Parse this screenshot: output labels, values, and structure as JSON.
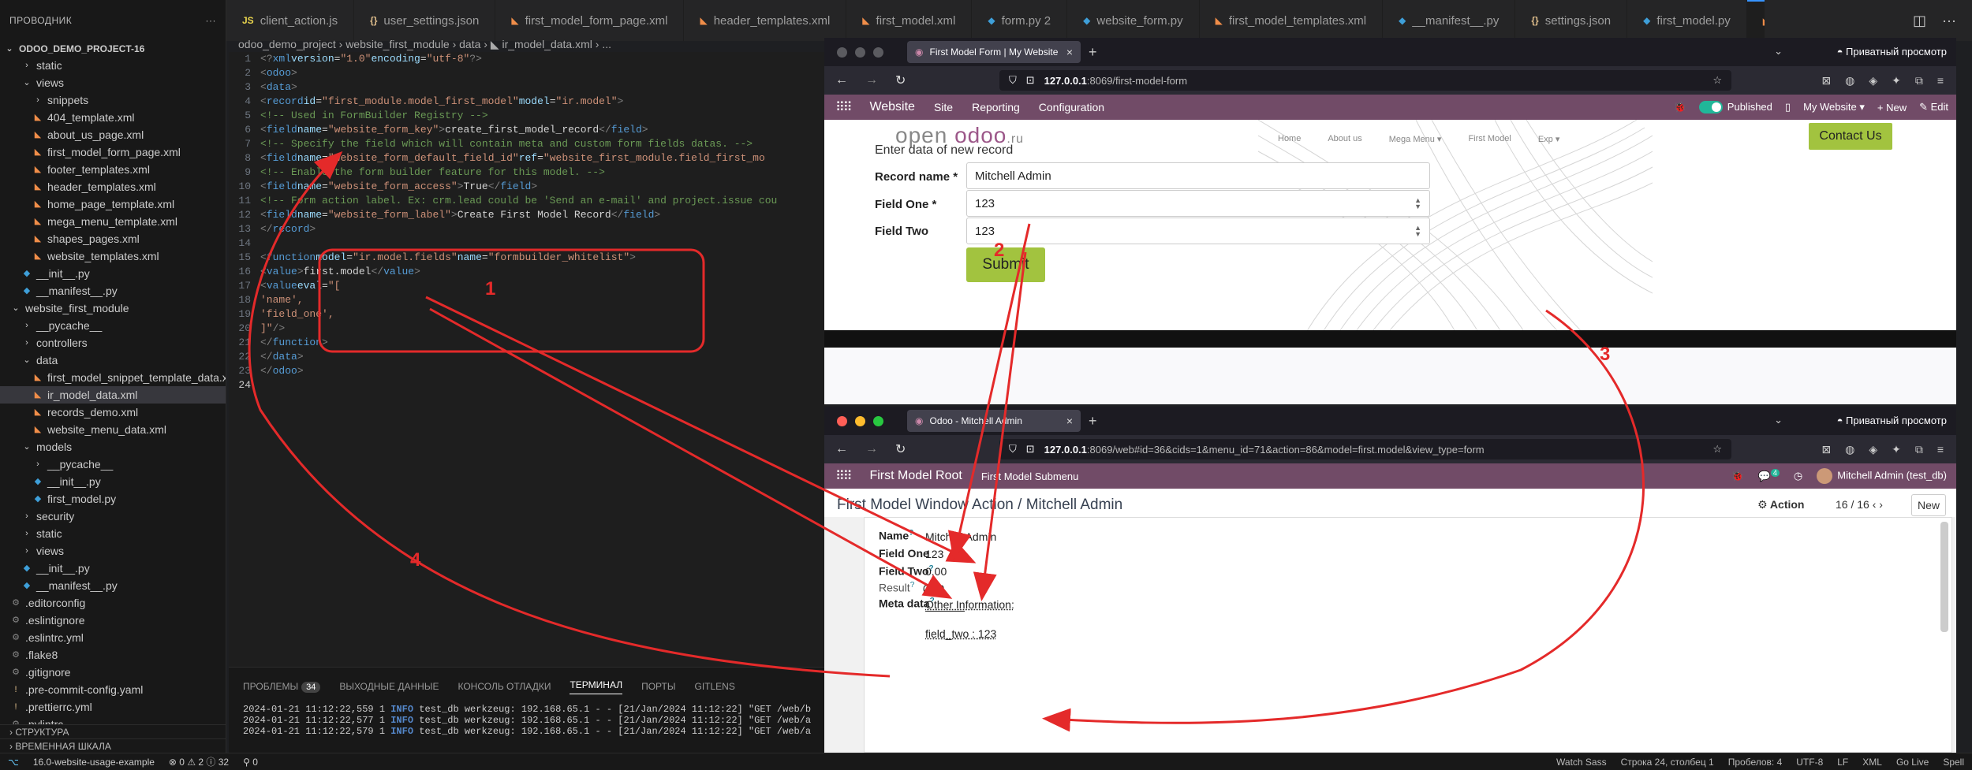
{
  "vscode": {
    "explorer_title": "ПРОВОДНИК",
    "project": "ODOO_DEMO_PROJECT-16",
    "tabs": [
      {
        "label": "client_action.js",
        "icon": "JS"
      },
      {
        "label": "user_settings.json",
        "icon": "{}"
      },
      {
        "label": "first_model_form_page.xml",
        "icon": "◣"
      },
      {
        "label": "header_templates.xml",
        "icon": "◣"
      },
      {
        "label": "first_model.xml",
        "icon": "◣"
      },
      {
        "label": "form.py 2",
        "icon": "◆"
      },
      {
        "label": "website_form.py",
        "icon": "◆"
      },
      {
        "label": "first_model_templates.xml",
        "icon": "◣"
      },
      {
        "label": "__manifest__.py",
        "icon": "◆"
      },
      {
        "label": "settings.json",
        "icon": "{}"
      },
      {
        "label": "first_model.py",
        "icon": "◆"
      },
      {
        "label": "ir_model_data.xml",
        "icon": "◣"
      }
    ],
    "tree": [
      {
        "label": "static",
        "depth": 1,
        "kind": "folder",
        "arrow": "›"
      },
      {
        "label": "views",
        "depth": 1,
        "kind": "folder",
        "arrow": "⌄"
      },
      {
        "label": "snippets",
        "depth": 2,
        "kind": "folder",
        "arrow": "›"
      },
      {
        "label": "404_template.xml",
        "depth": 2,
        "kind": "xml"
      },
      {
        "label": "about_us_page.xml",
        "depth": 2,
        "kind": "xml"
      },
      {
        "label": "first_model_form_page.xml",
        "depth": 2,
        "kind": "xml"
      },
      {
        "label": "footer_templates.xml",
        "depth": 2,
        "kind": "xml"
      },
      {
        "label": "header_templates.xml",
        "depth": 2,
        "kind": "xml"
      },
      {
        "label": "home_page_template.xml",
        "depth": 2,
        "kind": "xml"
      },
      {
        "label": "mega_menu_template.xml",
        "depth": 2,
        "kind": "xml"
      },
      {
        "label": "shapes_pages.xml",
        "depth": 2,
        "kind": "xml"
      },
      {
        "label": "website_templates.xml",
        "depth": 2,
        "kind": "xml"
      },
      {
        "label": "__init__.py",
        "depth": 1,
        "kind": "py"
      },
      {
        "label": "__manifest__.py",
        "depth": 1,
        "kind": "py"
      },
      {
        "label": "website_first_module",
        "depth": 0,
        "kind": "folder",
        "arrow": "⌄"
      },
      {
        "label": "__pycache__",
        "depth": 1,
        "kind": "folder",
        "arrow": "›"
      },
      {
        "label": "controllers",
        "depth": 1,
        "kind": "folder",
        "arrow": "›"
      },
      {
        "label": "data",
        "depth": 1,
        "kind": "folder",
        "arrow": "⌄"
      },
      {
        "label": "first_model_snippet_template_data.x...",
        "depth": 2,
        "kind": "xml"
      },
      {
        "label": "ir_model_data.xml",
        "depth": 2,
        "kind": "xml",
        "selected": true
      },
      {
        "label": "records_demo.xml",
        "depth": 2,
        "kind": "xml"
      },
      {
        "label": "website_menu_data.xml",
        "depth": 2,
        "kind": "xml"
      },
      {
        "label": "models",
        "depth": 1,
        "kind": "folder",
        "arrow": "⌄"
      },
      {
        "label": "__pycache__",
        "depth": 2,
        "kind": "folder",
        "arrow": "›"
      },
      {
        "label": "__init__.py",
        "depth": 2,
        "kind": "py"
      },
      {
        "label": "first_model.py",
        "depth": 2,
        "kind": "py"
      },
      {
        "label": "security",
        "depth": 1,
        "kind": "folder",
        "arrow": "›"
      },
      {
        "label": "static",
        "depth": 1,
        "kind": "folder",
        "arrow": "›"
      },
      {
        "label": "views",
        "depth": 1,
        "kind": "folder",
        "arrow": "›"
      },
      {
        "label": "__init__.py",
        "depth": 1,
        "kind": "py"
      },
      {
        "label": "__manifest__.py",
        "depth": 1,
        "kind": "py"
      },
      {
        "label": ".editorconfig",
        "depth": 0,
        "kind": "cfg"
      },
      {
        "label": ".eslintignore",
        "depth": 0,
        "kind": "cfg"
      },
      {
        "label": ".eslintrc.yml",
        "depth": 0,
        "kind": "cfg"
      },
      {
        "label": ".flake8",
        "depth": 0,
        "kind": "cfg"
      },
      {
        "label": ".gitignore",
        "depth": 0,
        "kind": "cfg"
      },
      {
        "label": ".pre-commit-config.yaml",
        "depth": 0,
        "kind": "yml"
      },
      {
        "label": ".prettierrc.yml",
        "depth": 0,
        "kind": "yml"
      },
      {
        "label": ".pylintrc",
        "depth": 0,
        "kind": "cfg"
      }
    ],
    "outline": "СТРУКТУРА",
    "timeline": "ВРЕМЕННАЯ ШКАЛА",
    "breadcrumbs": "odoo_demo_project  ›  website_first_module  ›  data  ›  ◣ ir_model_data.xml  ›  ...",
    "panel_tabs": [
      "ПРОБЛЕМЫ",
      "ВЫХОДНЫЕ ДАННЫЕ",
      "КОНСОЛЬ ОТЛАДКИ",
      "ТЕРМИНАЛ",
      "ПОРТЫ",
      "GITLENS"
    ],
    "problems_count": "34",
    "terminal": [
      {
        "ts": "2024-01-21 11:12:22,559 1 ",
        "lvl": "INFO",
        "rest": " test_db werkzeug: 192.168.65.1 - - [21/Jan/2024 11:12:22] \"GET /web/bundle"
      },
      {
        "ts": "2024-01-21 11:12:22,577 1 ",
        "lvl": "INFO",
        "rest": " test_db werkzeug: 192.168.65.1 - - [21/Jan/2024 11:12:22] \"GET /web/assets"
      },
      {
        "ts": "2024-01-21 11:12:22,579 1 ",
        "lvl": "INFO",
        "rest": " test_db werkzeug: 192.168.65.1 - - [21/Jan/2024 11:12:22] \"GET /web/assets"
      }
    ],
    "status_left": [
      "16.0-website-usage-example",
      "⊗ 0 ⚠ 2 ⓘ 32",
      "⚲ 0"
    ],
    "status_right": [
      "Watch Sass",
      "Строка 24, столбец 1",
      "Пробелов: 4",
      "UTF-8",
      "LF",
      "XML",
      "Go Live",
      "Spell"
    ]
  },
  "browser1": {
    "tab_title": "First Model Form | My Website",
    "url_host": "127.0.0.1",
    "url_rest": ":8069/first-model-form",
    "private": "Приватный просмотр",
    "bar": {
      "app": "Website",
      "menu": [
        "Site",
        "Reporting",
        "Configuration"
      ],
      "published": "Published",
      "site": "My Website ▾",
      "new": "+ New",
      "edit": "✎ Edit"
    },
    "nav": [
      "Home",
      "About us",
      "Mega Menu ▾",
      "First Model",
      "Exp ▾"
    ],
    "contact": "Contact Us",
    "logo_a": "open ",
    "logo_b": "odoo",
    "logo_c": ".ru",
    "form_title": "Enter data of new record",
    "fields": [
      {
        "label": "Record name *",
        "value": "Mitchell Admin"
      },
      {
        "label": "Field One *",
        "value": "123"
      },
      {
        "label": "Field Two",
        "value": "123"
      }
    ],
    "submit": "Submit"
  },
  "browser2": {
    "tab_title": "Odoo - Mitchell Admin",
    "url_host": "127.0.0.1",
    "url_rest": ":8069/web#id=36&cids=1&menu_id=71&action=86&model=first.model&view_type=form",
    "private": "Приватный просмотр",
    "app": "First Model Root",
    "submenu": "First Model Submenu",
    "chat_count": "4",
    "user": "Mitchell Admin (test_db)",
    "breadcrumb": "First Model Window Action / Mitchell Admin",
    "action": "⚙ Action",
    "pager": "16 / 16",
    "new": "New",
    "fields": [
      {
        "label": "Name",
        "value": "Mitchell Admin"
      },
      {
        "label": "Field One",
        "value": "123"
      },
      {
        "label": "Field Two",
        "value": "0.00"
      },
      {
        "label": "Result",
        "value": "0.00"
      },
      {
        "label": "Meta data",
        "value": "Other Information:"
      }
    ],
    "meta_line": "field_two : 123"
  },
  "annotations": [
    "1",
    "2",
    "3",
    "4"
  ],
  "colors": {
    "odoo_purple": "#714b67",
    "accent_green": "#a2c33f",
    "arrow_red": "#e42a2a",
    "vscode_blue": "#3794ff"
  }
}
